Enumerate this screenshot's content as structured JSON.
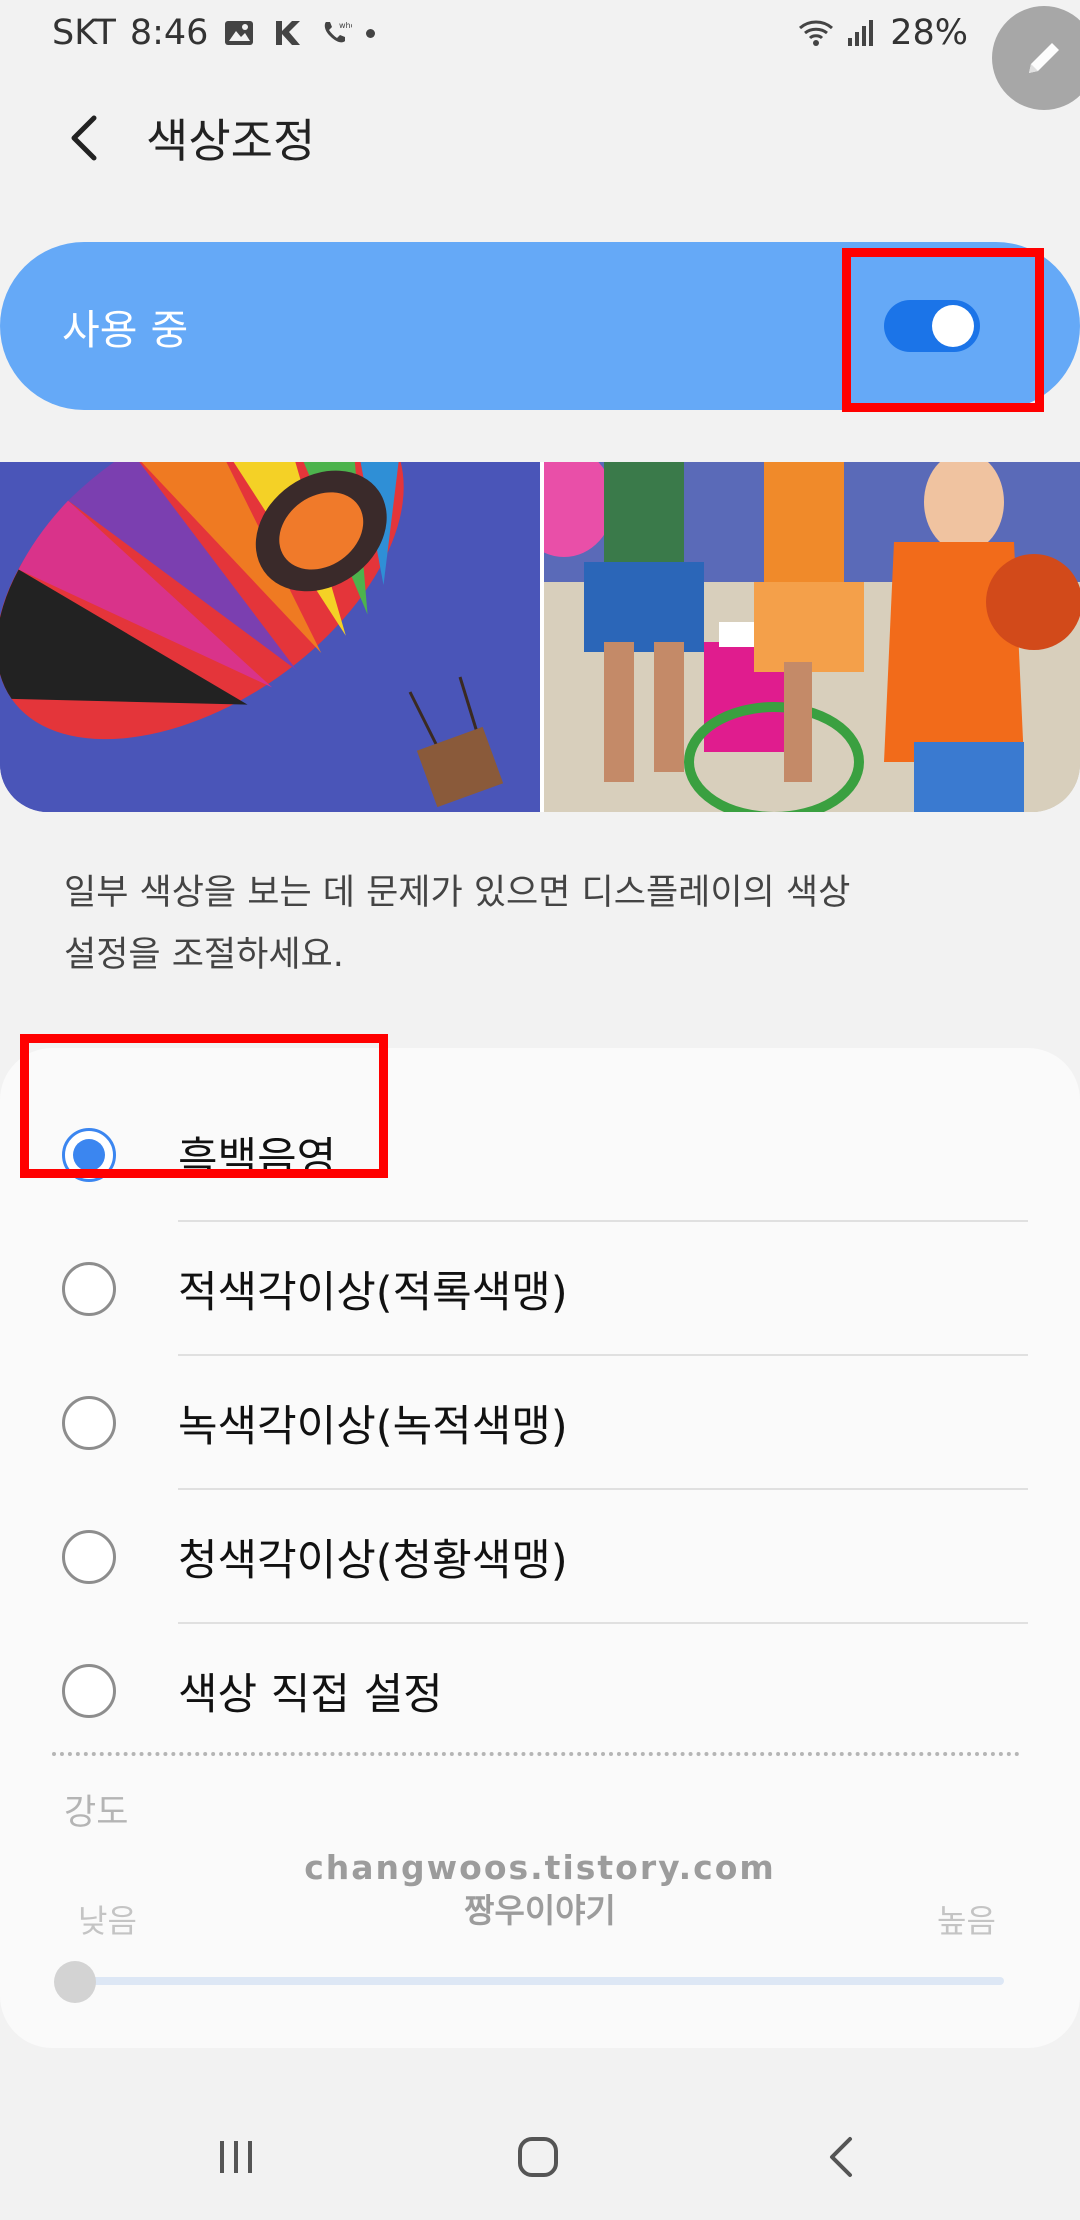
{
  "status_bar": {
    "carrier": "SKT",
    "time": "8:46",
    "battery": "28%"
  },
  "app_bar": {
    "title": "색상조정"
  },
  "master_switch": {
    "label": "사용 중",
    "on": true
  },
  "description": {
    "line1": "일부 색상을 보는 데 문제가 있으면 디스플레이의 색상",
    "line2": "설정을 조절하세요."
  },
  "options": [
    {
      "label": "흑백음영",
      "selected": true
    },
    {
      "label": "적색각이상(적록색맹)",
      "selected": false
    },
    {
      "label": "녹색각이상(녹적색맹)",
      "selected": false
    },
    {
      "label": "청색각이상(청황색맹)",
      "selected": false
    },
    {
      "label": "색상 직접 설정",
      "selected": false
    }
  ],
  "intensity": {
    "title": "강도",
    "low_label": "낮음",
    "high_label": "높음",
    "value": 0
  },
  "watermark": {
    "line1": "changwoos.tistory.com",
    "line2": "짱우이야기"
  },
  "colors": {
    "accent": "#65a9f7",
    "toggle_on": "#1b74e8",
    "radio_selected": "#3b86f0",
    "highlight_box": "#ff0000"
  }
}
